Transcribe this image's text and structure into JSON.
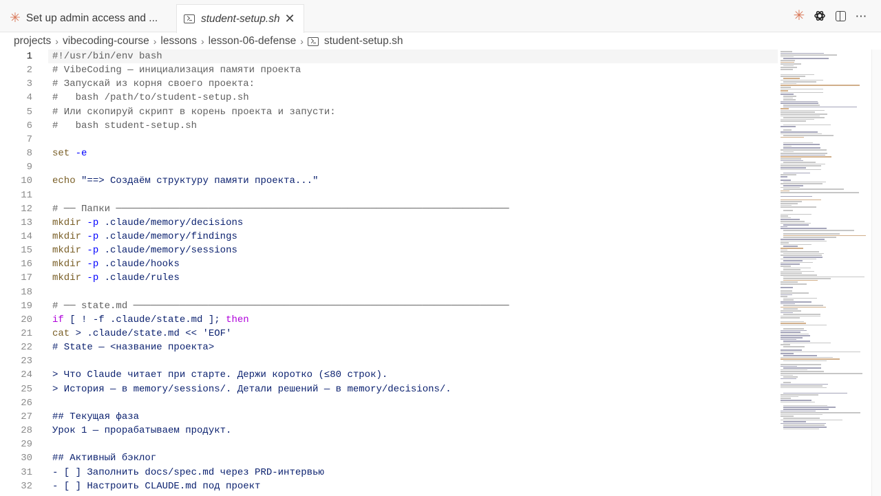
{
  "tabs": [
    {
      "label": "Set up admin access and ...",
      "icon": "claude-spark-icon"
    },
    {
      "label": "student-setup.sh",
      "icon": "terminal-icon",
      "active": true
    }
  ],
  "breadcrumb": [
    "projects",
    "vibecoding-course",
    "lessons",
    "lesson-06-defense",
    "student-setup.sh"
  ],
  "editor": {
    "current_line": 1,
    "lines": [
      {
        "n": "1",
        "parts": [
          [
            "c-comment",
            "#!/usr/bin/env bash"
          ]
        ]
      },
      {
        "n": "2",
        "parts": [
          [
            "c-comment",
            "# VibeCoding — инициализация памяти проекта"
          ]
        ]
      },
      {
        "n": "3",
        "parts": [
          [
            "c-comment",
            "# Запускай из корня своего проекта:"
          ]
        ]
      },
      {
        "n": "4",
        "parts": [
          [
            "c-comment",
            "#   bash /path/to/student-setup.sh"
          ]
        ]
      },
      {
        "n": "5",
        "parts": [
          [
            "c-comment",
            "# Или скопируй скрипт в корень проекта и запусти:"
          ]
        ]
      },
      {
        "n": "6",
        "parts": [
          [
            "c-comment",
            "#   bash student-setup.sh"
          ]
        ]
      },
      {
        "n": "7",
        "parts": []
      },
      {
        "n": "8",
        "parts": [
          [
            "c-kw",
            "set"
          ],
          [
            "",
            " "
          ],
          [
            "c-flag",
            "-e"
          ]
        ]
      },
      {
        "n": "9",
        "parts": []
      },
      {
        "n": "10",
        "parts": [
          [
            "c-kw",
            "echo"
          ],
          [
            "",
            " "
          ],
          [
            "c-str",
            "\"==> Создаём структуру памяти проекта...\""
          ]
        ]
      },
      {
        "n": "11",
        "parts": []
      },
      {
        "n": "12",
        "parts": [
          [
            "c-comment",
            "# ── Папки ────────────────────────────────────────────────────────────────────"
          ]
        ]
      },
      {
        "n": "13",
        "parts": [
          [
            "c-kw",
            "mkdir"
          ],
          [
            "",
            " "
          ],
          [
            "c-flag",
            "-p"
          ],
          [
            "c-txt",
            " .claude/memory/decisions"
          ]
        ]
      },
      {
        "n": "14",
        "parts": [
          [
            "c-kw",
            "mkdir"
          ],
          [
            "",
            " "
          ],
          [
            "c-flag",
            "-p"
          ],
          [
            "c-txt",
            " .claude/memory/findings"
          ]
        ]
      },
      {
        "n": "15",
        "parts": [
          [
            "c-kw",
            "mkdir"
          ],
          [
            "",
            " "
          ],
          [
            "c-flag",
            "-p"
          ],
          [
            "c-txt",
            " .claude/memory/sessions"
          ]
        ]
      },
      {
        "n": "16",
        "parts": [
          [
            "c-kw",
            "mkdir"
          ],
          [
            "",
            " "
          ],
          [
            "c-flag",
            "-p"
          ],
          [
            "c-txt",
            " .claude/hooks"
          ]
        ]
      },
      {
        "n": "17",
        "parts": [
          [
            "c-kw",
            "mkdir"
          ],
          [
            "",
            " "
          ],
          [
            "c-flag",
            "-p"
          ],
          [
            "c-txt",
            " .claude/rules"
          ]
        ]
      },
      {
        "n": "18",
        "parts": []
      },
      {
        "n": "19",
        "parts": [
          [
            "c-comment",
            "# ── state.md ─────────────────────────────────────────────────────────────────"
          ]
        ]
      },
      {
        "n": "20",
        "parts": [
          [
            "c-ctl",
            "if"
          ],
          [
            "c-txt",
            " [ ! -f .claude/state.md ]; "
          ],
          [
            "c-ctl",
            "then"
          ]
        ]
      },
      {
        "n": "21",
        "parts": [
          [
            "c-kw",
            "cat"
          ],
          [
            "c-txt",
            " > .claude/state.md << 'EOF'"
          ]
        ]
      },
      {
        "n": "22",
        "parts": [
          [
            "c-txt",
            "# State — <название проекта>"
          ]
        ]
      },
      {
        "n": "23",
        "parts": []
      },
      {
        "n": "24",
        "parts": [
          [
            "c-txt",
            "> Что Claude читает при старте. Держи коротко (≤80 строк)."
          ]
        ]
      },
      {
        "n": "25",
        "parts": [
          [
            "c-txt",
            "> История — в memory/sessions/. Детали решений — в memory/decisions/."
          ]
        ]
      },
      {
        "n": "26",
        "parts": []
      },
      {
        "n": "27",
        "parts": [
          [
            "c-txt",
            "## Текущая фаза"
          ]
        ]
      },
      {
        "n": "28",
        "parts": [
          [
            "c-txt",
            "Урок 1 — прорабатываем продукт."
          ]
        ]
      },
      {
        "n": "29",
        "parts": []
      },
      {
        "n": "30",
        "parts": [
          [
            "c-txt",
            "## Активный бэклог"
          ]
        ]
      },
      {
        "n": "31",
        "parts": [
          [
            "c-txt",
            "- [ ] Заполнить docs/spec.md через PRD-интервью"
          ]
        ]
      },
      {
        "n": "32",
        "parts": [
          [
            "c-txt",
            "- [ ] Настроить CLAUDE.md под проект"
          ]
        ]
      }
    ]
  },
  "colors": {
    "accent_spark": "#d97757",
    "keyword": "#795e26",
    "flag": "#0000ff",
    "control": "#af00db",
    "comment": "#5f5f5f"
  }
}
